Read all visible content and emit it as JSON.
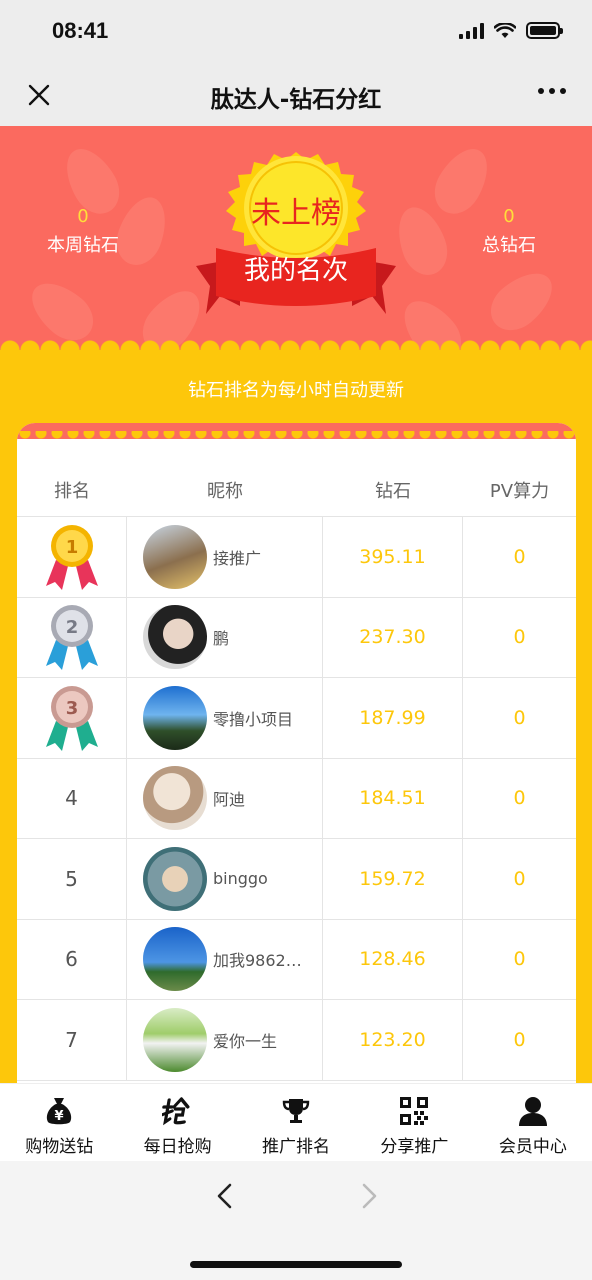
{
  "status_bar": {
    "time": "08:41"
  },
  "navbar": {
    "title": "肽达人-钻石分红"
  },
  "hero": {
    "weekly": {
      "value": "0",
      "label": "本周钻石"
    },
    "total": {
      "value": "0",
      "label": "总钻石"
    },
    "badge_status": "未上榜",
    "badge_ribbon": "我的名次"
  },
  "notice": "钻石排名为每小时自动更新",
  "table": {
    "headers": [
      "排名",
      "昵称",
      "钻石",
      "PV算力"
    ],
    "rows": [
      {
        "rank": "1",
        "medal": "gold",
        "name": "接推广",
        "diamonds": "395.11",
        "pv": "0"
      },
      {
        "rank": "2",
        "medal": "silver",
        "name": "鹏",
        "diamonds": "237.30",
        "pv": "0"
      },
      {
        "rank": "3",
        "medal": "bronze",
        "name": "零撸小项目",
        "diamonds": "187.99",
        "pv": "0"
      },
      {
        "rank": "4",
        "medal": "",
        "name": "阿迪",
        "diamonds": "184.51",
        "pv": "0"
      },
      {
        "rank": "5",
        "medal": "",
        "name": "binggo",
        "diamonds": "159.72",
        "pv": "0"
      },
      {
        "rank": "6",
        "medal": "",
        "name": "加我9862…",
        "diamonds": "128.46",
        "pv": "0"
      },
      {
        "rank": "7",
        "medal": "",
        "name": "爱你一生",
        "diamonds": "123.20",
        "pv": "0"
      }
    ]
  },
  "tabbar": {
    "items": [
      {
        "label": "购物送钻",
        "icon": "money-bag-icon"
      },
      {
        "label": "每日抢购",
        "icon": "grab-icon"
      },
      {
        "label": "推广排名",
        "icon": "trophy-icon"
      },
      {
        "label": "分享推广",
        "icon": "qr-code-icon"
      },
      {
        "label": "会员中心",
        "icon": "user-icon"
      }
    ]
  },
  "colors": {
    "coral": "#fb6a5f",
    "yellow": "#fdc70b",
    "diamond_text": "#fdc70b"
  }
}
